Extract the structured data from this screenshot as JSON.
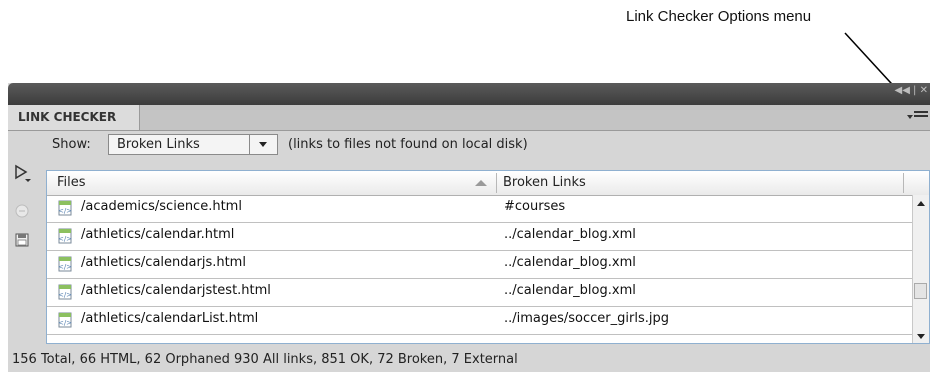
{
  "annotation": {
    "callout": "Link Checker Options menu"
  },
  "panel": {
    "tab_label": "LINK CHECKER",
    "show_label": "Show:",
    "show_selected": "Broken Links",
    "show_description": "(links to files not found on local disk)",
    "columns": [
      "Files",
      "Broken Links"
    ],
    "rows": [
      {
        "file": "/academics/science.html",
        "link": "#courses"
      },
      {
        "file": "/athletics/calendar.html",
        "link": "../calendar_blog.xml"
      },
      {
        "file": "/athletics/calendarjs.html",
        "link": "../calendar_blog.xml"
      },
      {
        "file": "/athletics/calendarjstest.html",
        "link": "../calendar_blog.xml"
      },
      {
        "file": "/athletics/calendarList.html",
        "link": "../images/soccer_girls.jpg"
      }
    ],
    "status": "156 Total, 66 HTML, 62 Orphaned  930 All links, 851 OK, 72 Broken, 7 External"
  },
  "icons": {
    "run": "play-icon",
    "stop": "stop-icon",
    "save": "save-icon",
    "file": "html-file-icon",
    "options": "options-menu-icon"
  }
}
